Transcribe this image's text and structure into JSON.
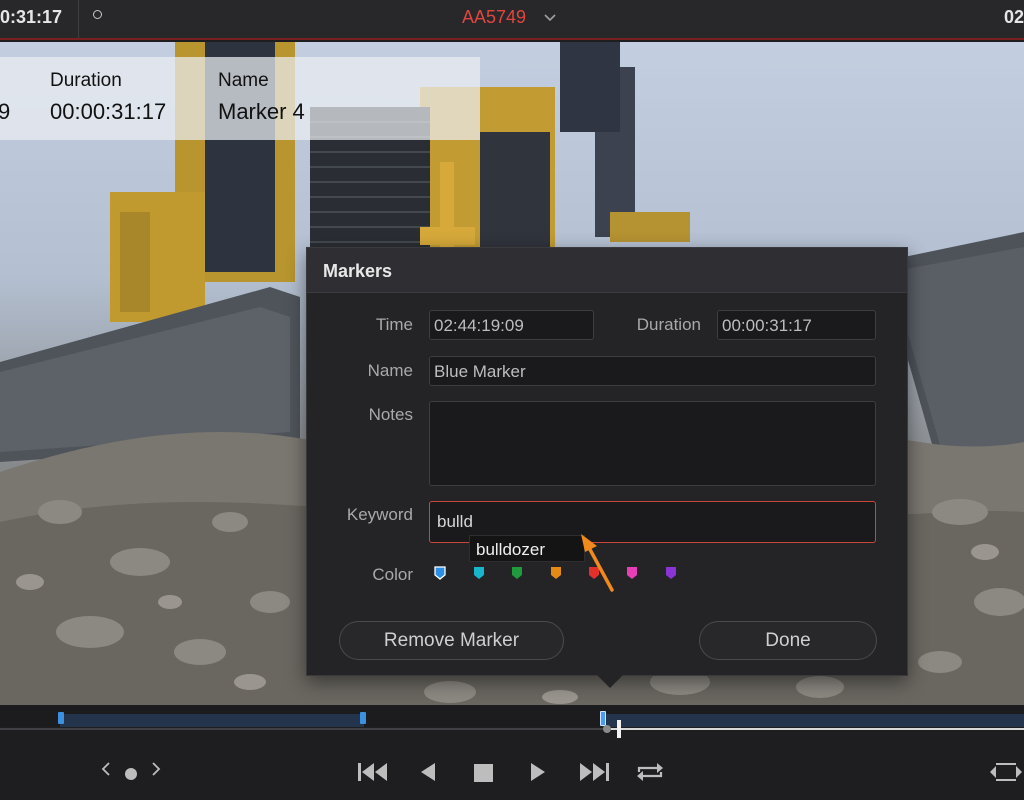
{
  "topbar": {
    "timecode_left": "0:31:17",
    "clip_title": "AA5749",
    "timecode_right": "02"
  },
  "overlay": {
    "prefix_value": "9",
    "duration_label": "Duration",
    "duration_value": "00:00:31:17",
    "name_label": "Name",
    "name_value": "Marker 4"
  },
  "dialog": {
    "title": "Markers",
    "time_label": "Time",
    "time_value": "02:44:19:09",
    "duration_label": "Duration",
    "duration_value": "00:00:31:17",
    "name_label": "Name",
    "name_value": "Blue Marker",
    "notes_label": "Notes",
    "notes_value": "",
    "keyword_label": "Keyword",
    "keyword_value": "bulld",
    "suggestion": "bulldozer",
    "color_label": "Color",
    "colors": [
      "#2b8fe8",
      "#17b6c8",
      "#1f9a3c",
      "#e58a12",
      "#e2312a",
      "#e83fb6",
      "#8a34d6"
    ],
    "selected_color": "blue",
    "remove_button": "Remove Marker",
    "done_button": "Done"
  },
  "accent_colors": {
    "title_red": "#e0463d",
    "marker_blue": "#3d8fe0",
    "cursor_orange": "#f08a1c"
  },
  "transport": {
    "icons": [
      "prev-icon",
      "dot-icon",
      "next-icon",
      "jump-start-icon",
      "reverse-play-icon",
      "stop-icon",
      "play-icon",
      "jump-end-icon",
      "loop-icon",
      "fullscreen-icon"
    ]
  }
}
